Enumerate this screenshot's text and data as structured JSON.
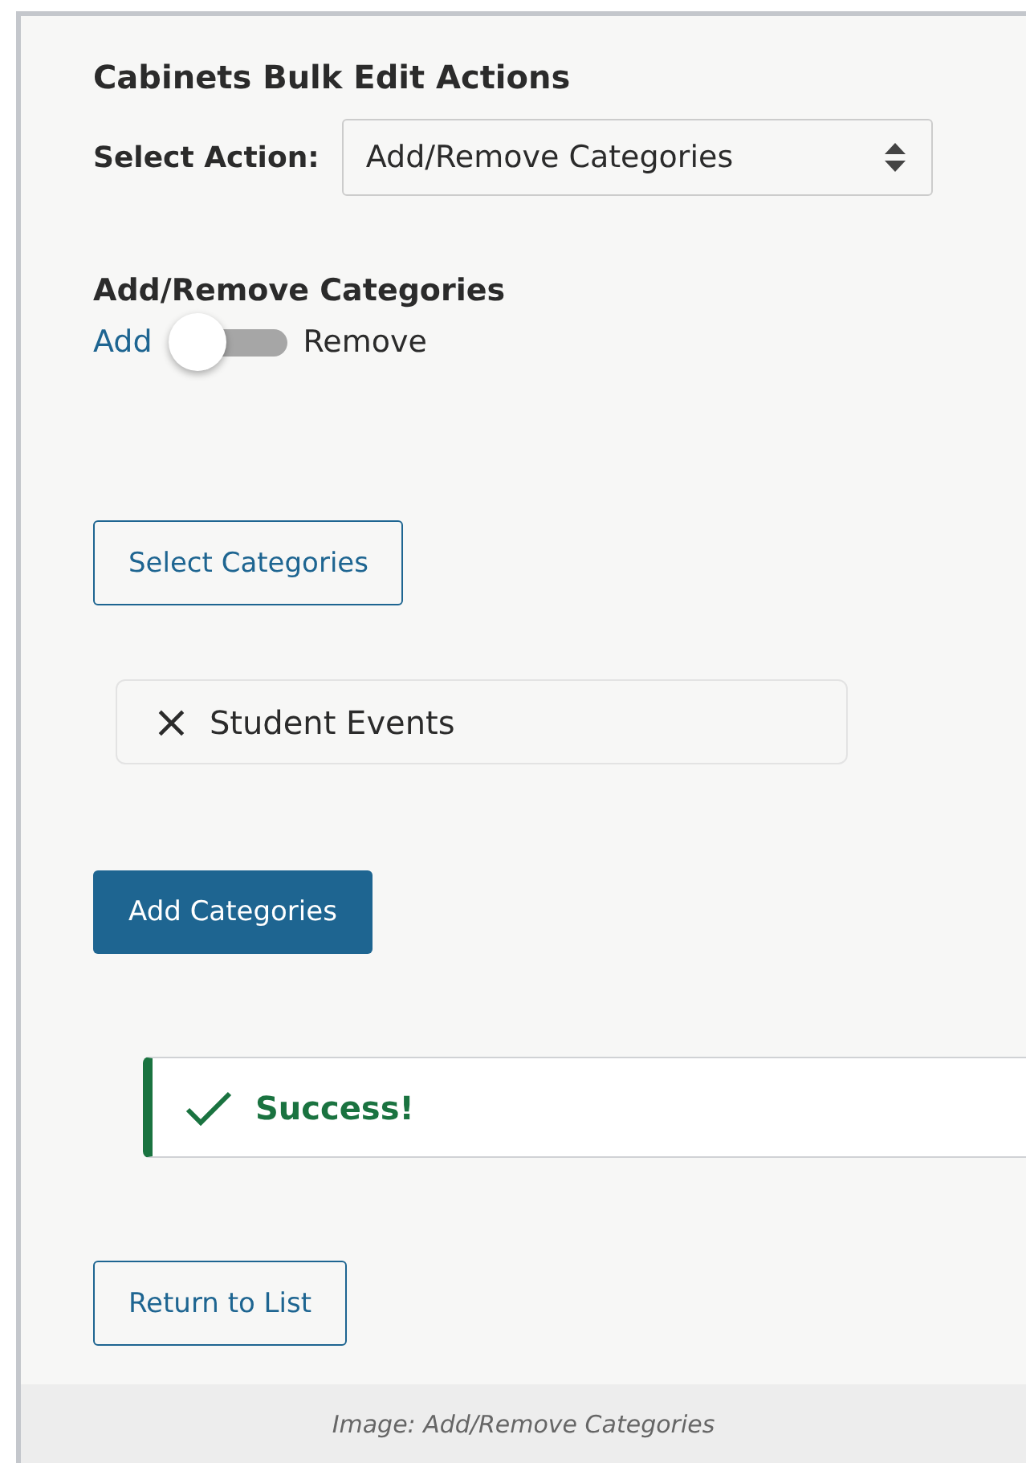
{
  "title": "Cabinets Bulk Edit Actions",
  "action": {
    "label": "Select Action:",
    "value": "Add/Remove Categories"
  },
  "section": {
    "heading": "Add/Remove Categories",
    "toggle": {
      "left_label": "Add",
      "right_label": "Remove",
      "on": false
    }
  },
  "select_button": "Select Categories",
  "chips": [
    {
      "remove": "×",
      "label": "Student Events"
    }
  ],
  "submit_button": "Add Categories",
  "alert": {
    "kind": "success",
    "text": "Success!"
  },
  "return_button": "Return to List",
  "caption": "Image: Add/Remove Categories"
}
